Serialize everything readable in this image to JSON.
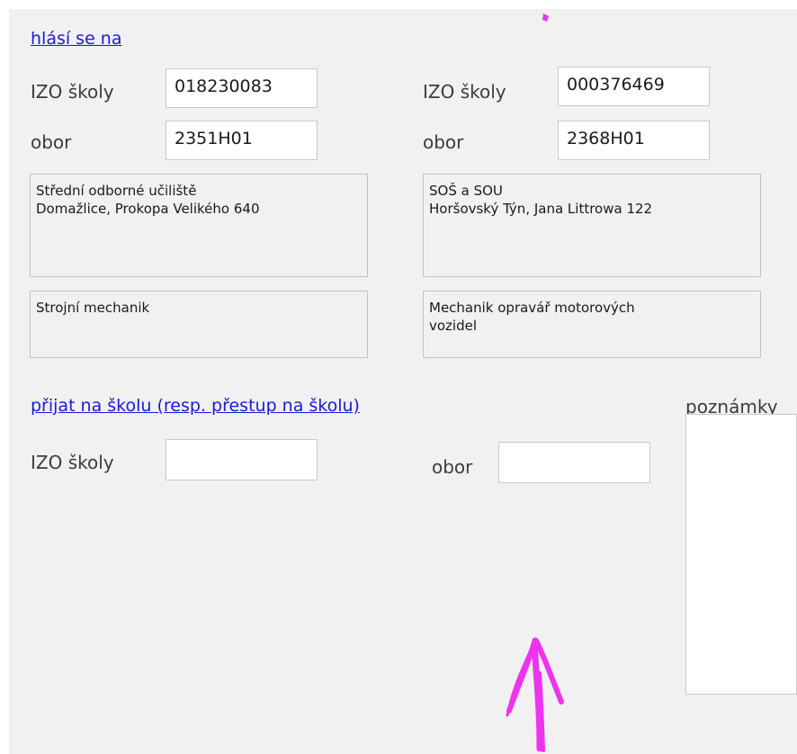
{
  "header": {
    "applies_to_link": "hlásí se na"
  },
  "school1": {
    "izo_label": "IZO školy",
    "izo_value": "018230083",
    "obor_label": "obor",
    "obor_value": "2351H01",
    "school_name": "Střední odborné učiliště\nDomažlice, Prokopa Velikého 640",
    "field_name": "Strojní mechanik"
  },
  "school2": {
    "izo_label": "IZO školy",
    "izo_value": "000376469",
    "obor_label": "obor",
    "obor_value": "2368H01",
    "school_name": "SOŠ a SOU\nHoršovský Týn, Jana Littrowa 122",
    "field_name": "Mechanik opravář motorových\nvozidel"
  },
  "accepted": {
    "link": "přijat na školu (resp. přestup na školu)",
    "izo_label": "IZO školy",
    "izo_value": "",
    "obor_label": "obor",
    "obor_value": ""
  },
  "notes": {
    "label": "poznámky",
    "value": ""
  },
  "annotation": {
    "color": "#ee33ee",
    "icon": "hand-drawn-up-arrow"
  }
}
